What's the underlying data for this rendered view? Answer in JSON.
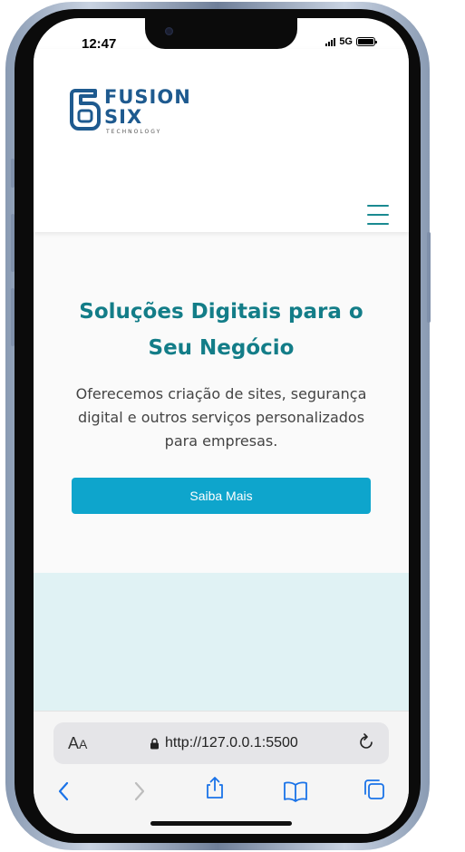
{
  "status_bar": {
    "time": "12:47",
    "network": "5G",
    "battery_level": 1.0
  },
  "logo": {
    "line1": "FUSION",
    "line2": "SIX",
    "line3": "TECHNOLOGY"
  },
  "hero": {
    "title": "Soluções Digitais para o Seu Negócio",
    "description": "Oferecemos criação de sites, segurança digital e outros serviços personalizados para empresas.",
    "cta_label": "Saiba Mais"
  },
  "browser": {
    "text_size_label": "AA",
    "url": "http://127.0.0.1:5500",
    "icons": [
      "lock-icon",
      "reload-icon",
      "back-icon",
      "forward-icon",
      "share-icon",
      "bookmarks-icon",
      "tabs-icon"
    ]
  },
  "colors": {
    "brand_blue": "#1e5a8f",
    "accent_teal": "#137d88",
    "cta_background": "#0ea5cc",
    "section_background": "#e0f2f4",
    "safari_blue": "#1a73e8"
  }
}
